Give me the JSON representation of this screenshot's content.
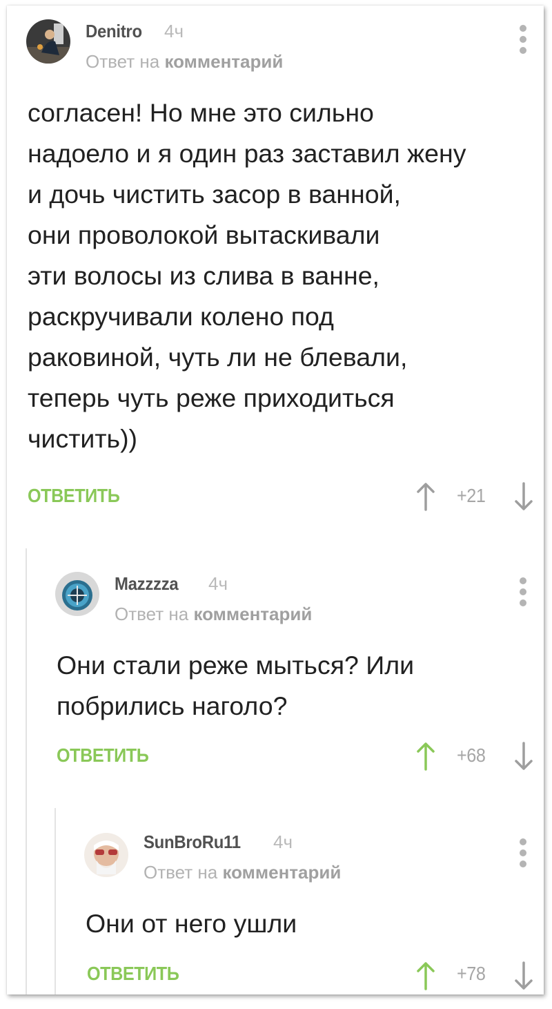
{
  "comments": [
    {
      "author": "Denitro",
      "time": "4ч",
      "reply_prefix": "Ответ на",
      "reply_target": "комментарий",
      "text": "согласен! Но мне это сильно\nнадоело и я один раз заставил жену\nи дочь чистить засор в ванной,\nони проволокой вытаскивали\nэти волосы из слива в ванне,\nраскручивали колено под\nраковиной, чуть ли не блевали,\nтеперь чуть реже приходиться\nчистить))",
      "reply_label": "ОТВЕТИТЬ",
      "rating": "+21",
      "upvoted": false,
      "avatar_icon": "user-photo-avatar"
    },
    {
      "author": "Mazzzza",
      "time": "4ч",
      "reply_prefix": "Ответ на",
      "reply_target": "комментарий",
      "text": "Они стали реже мыться? Или\nпобрились наголо?",
      "reply_label": "ОТВЕТИТЬ",
      "rating": "+68",
      "upvoted": true,
      "avatar_icon": "emblem-avatar"
    },
    {
      "author": "SunBroRu11",
      "time": "4ч",
      "reply_prefix": "Ответ на",
      "reply_target": "комментарий",
      "text": "Они от него ушли",
      "reply_label": "ОТВЕТИТЬ",
      "rating": "+78",
      "upvoted": true,
      "avatar_icon": "old-man-sunglasses-avatar"
    }
  ],
  "colors": {
    "accent_green": "#8ac858",
    "arrow_neutral": "#9e9e9e",
    "text_main": "#212121",
    "meta_grey": "#b2b2b2",
    "thread_line": "#e3e3e3"
  }
}
